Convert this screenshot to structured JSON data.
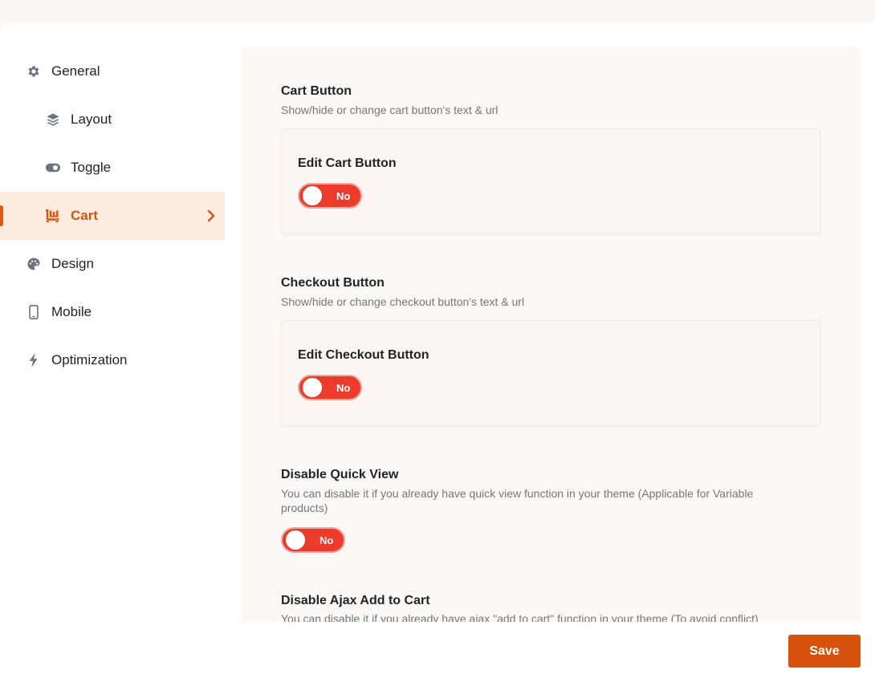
{
  "sidebar": {
    "items": [
      {
        "label": "General",
        "icon": "gear-icon"
      },
      {
        "label": "Layout",
        "icon": "layers-icon"
      },
      {
        "label": "Toggle",
        "icon": "toggle-icon"
      },
      {
        "label": "Cart",
        "icon": "cart-icon",
        "active": true
      },
      {
        "label": "Design",
        "icon": "palette-icon"
      },
      {
        "label": "Mobile",
        "icon": "mobile-icon"
      },
      {
        "label": "Optimization",
        "icon": "bolt-icon"
      }
    ]
  },
  "sections": [
    {
      "title": "Cart Button",
      "desc": "Show/hide or change cart button's text & url",
      "card_title": "Edit Cart Button",
      "toggle": "No"
    },
    {
      "title": "Checkout Button",
      "desc": "Show/hide or change checkout button's text & url",
      "card_title": "Edit Checkout Button",
      "toggle": "No"
    },
    {
      "title": "Disable Quick View",
      "desc": "You can disable it if you already have quick view function in your theme (Applicable for Variable products)",
      "toggle": "No"
    },
    {
      "title": "Disable Ajax Add to Cart",
      "desc": "You can disable it if you already have ajax \"add to cart\" function in your theme (To avoid conflict)"
    }
  ],
  "save_label": "Save",
  "colors": {
    "accent": "#d6520d",
    "toggle_off": "#ec3b2b",
    "active_bg": "#fcebdf",
    "icon_gray": "#6b7280"
  }
}
